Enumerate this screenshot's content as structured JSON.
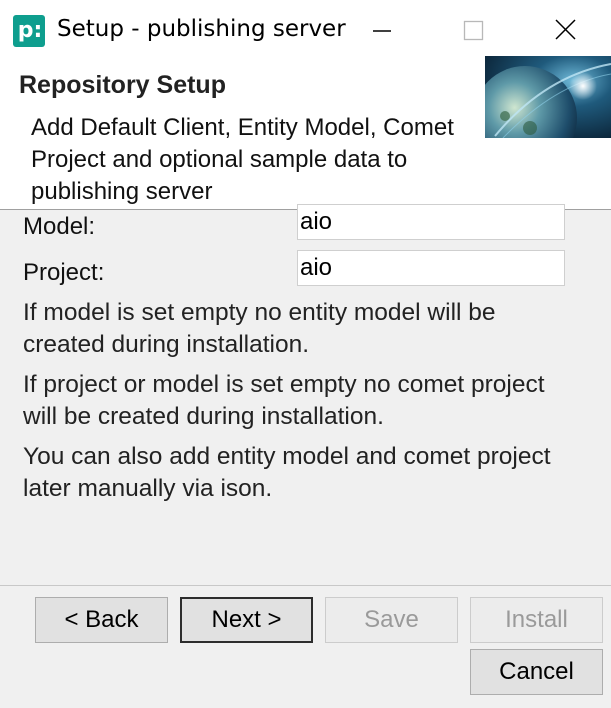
{
  "window": {
    "icon_glyph": "p:",
    "title": "Setup - publishing server",
    "controls": [
      "minimize-icon",
      "maximize-icon",
      "close-icon"
    ]
  },
  "header": {
    "title": "Repository Setup",
    "description": "Add Default Client, Entity Model, Comet Project and optional sample data to publishing server"
  },
  "form": {
    "model_label": "Model:",
    "model_value": "aio",
    "project_label": "Project:",
    "project_value": "aio"
  },
  "info": {
    "model_note": "If model is set empty no entity model will be created during installation.",
    "project_note": "If project or model is set empty no comet project will be created during installation.",
    "later_note": "You can also add entity model and comet project later manually via ison."
  },
  "buttons": {
    "back": "< Back",
    "next": "Next >",
    "save": "Save",
    "install": "Install",
    "cancel": "Cancel"
  },
  "colors": {
    "app_icon": "#0e9e8e",
    "window_bg": "#f0f0f0",
    "header_bg": "#ffffff",
    "disabled_text": "#9a9a9a"
  }
}
